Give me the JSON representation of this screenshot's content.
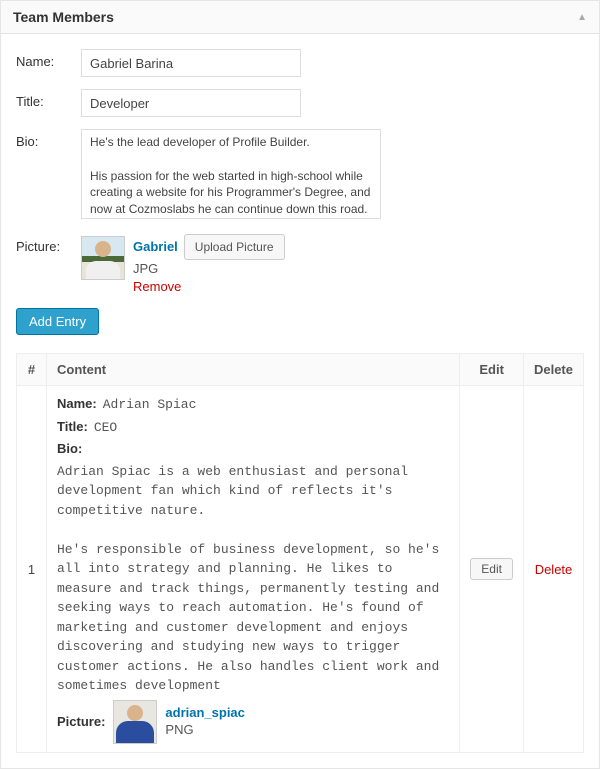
{
  "panel": {
    "title": "Team Members"
  },
  "form": {
    "labels": {
      "name": "Name:",
      "title": "Title:",
      "bio": "Bio:",
      "picture": "Picture:"
    },
    "values": {
      "name": "Gabriel Barina",
      "title": "Developer",
      "bio_part1": "He's the lead developer of Profile Builder.\n\nHis passion for the web started in high-school while creating a website for his Programmer's Degree, and now at ",
      "bio_misspell": "Cozmoslabs",
      "bio_part2": " he can continue down this road. Learning new things and overcoming obstacles, he is open for ideas"
    },
    "picture": {
      "filename": "Gabriel",
      "filetype": "JPG",
      "remove": "Remove",
      "upload": "Upload Picture"
    },
    "add_entry": "Add Entry"
  },
  "table": {
    "headers": {
      "num": "#",
      "content": "Content",
      "edit": "Edit",
      "delete": "Delete"
    },
    "rows": [
      {
        "index": "1",
        "name_label": "Name:",
        "name": "Adrian Spiac",
        "title_label": "Title:",
        "title": "CEO",
        "bio_label": "Bio:",
        "bio": "Adrian Spiac is a web enthusiast and personal development fan which kind of reflects it's competitive nature.\n\nHe's responsible of business development, so he's all into strategy and planning. He likes to measure and track things, permanently testing and seeking ways to reach automation. He's found of marketing and customer development and enjoys discovering and studying new ways to trigger customer actions. He also handles client work and sometimes development",
        "picture_label": "Picture:",
        "picture_filename": "adrian_spiac",
        "picture_filetype": "PNG",
        "edit": "Edit",
        "delete": "Delete"
      }
    ]
  }
}
